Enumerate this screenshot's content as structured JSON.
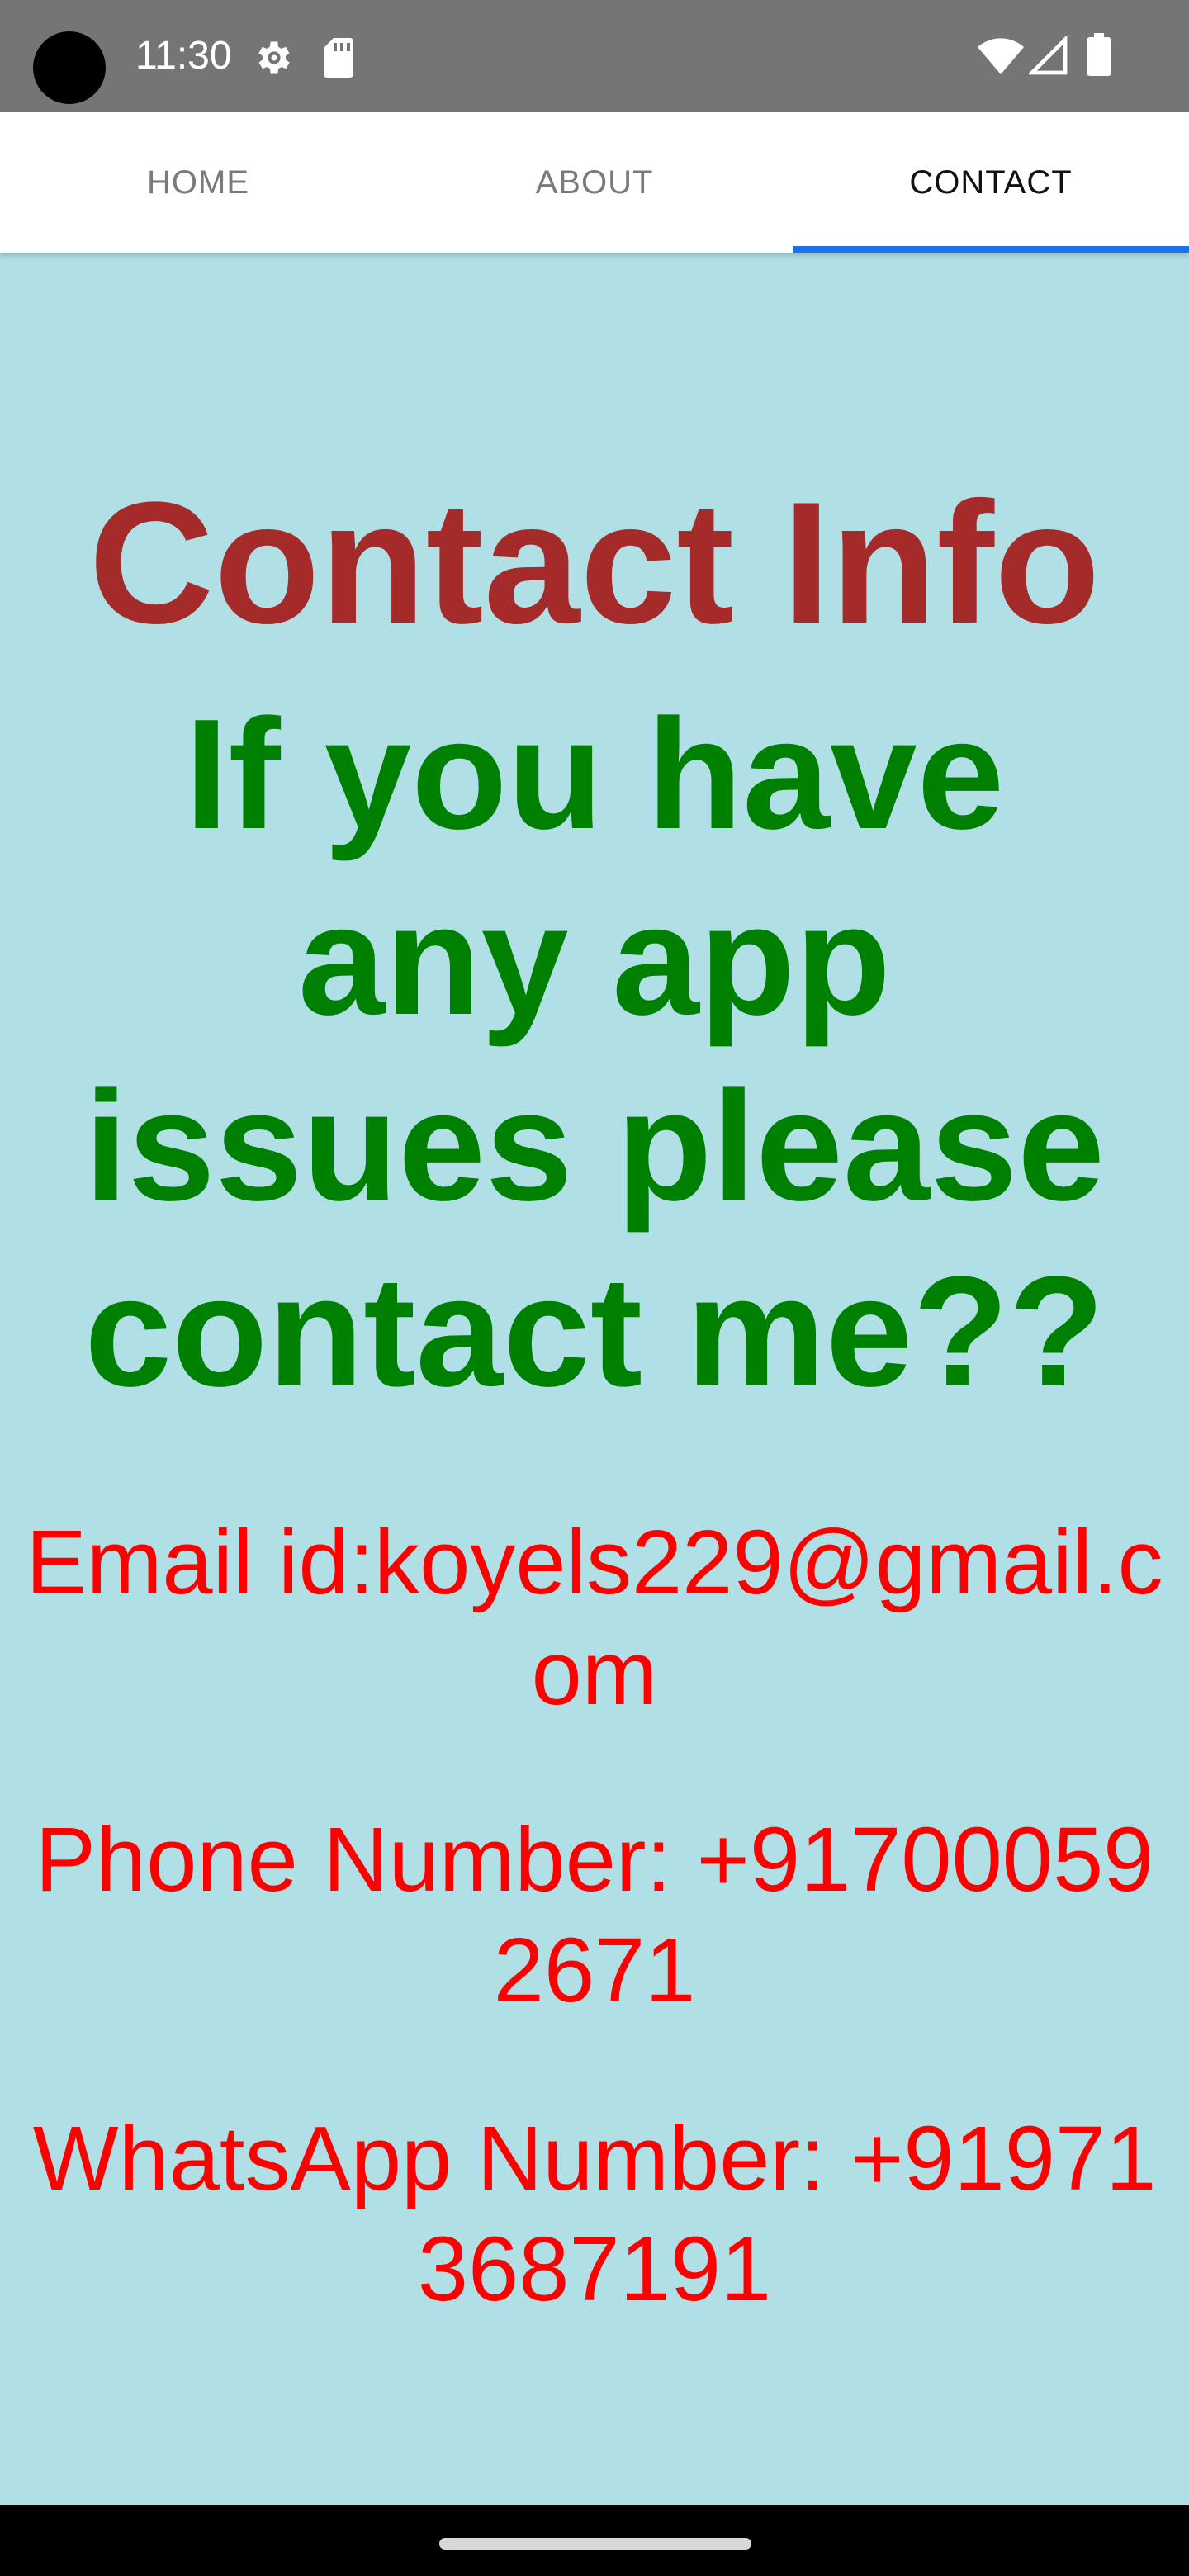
{
  "status_bar": {
    "time": "11:30",
    "icons": [
      "settings-gear-icon",
      "sd-card-icon",
      "wifi-icon",
      "cell-signal-icon",
      "battery-icon"
    ]
  },
  "tabs": [
    {
      "label": "HOME",
      "active": false
    },
    {
      "label": "ABOUT",
      "active": false
    },
    {
      "label": "CONTACT",
      "active": true
    }
  ],
  "content": {
    "title": "Contact Info",
    "subtitle": "If you have any app issues please contact me??",
    "email": "Email id:koyels229@gmail.com",
    "phone": "Phone Number: +917000592671",
    "whatsapp": "WhatsApp Number: +919713687191"
  },
  "colors": {
    "background": "#b0e0e6",
    "title": "#a52a2a",
    "subtitle": "#008000",
    "contact_text": "#ff0000",
    "tab_indicator": "#1a73e8",
    "status_bar": "#757575"
  }
}
